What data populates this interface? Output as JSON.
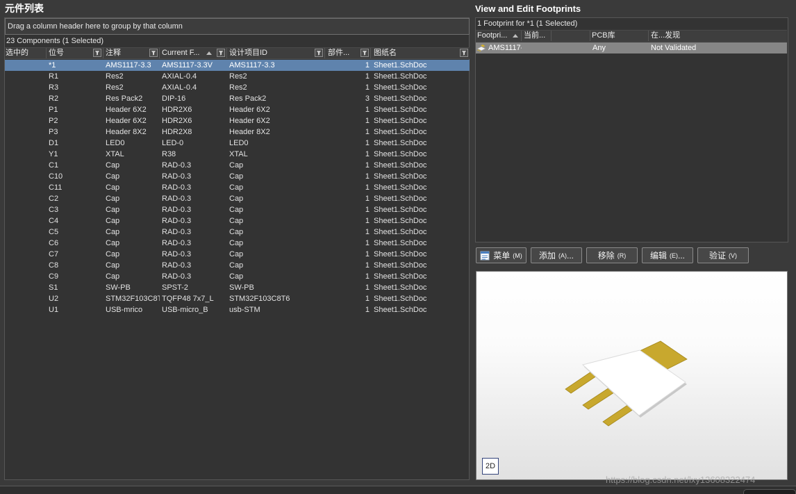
{
  "component_list": {
    "title": "元件列表",
    "group_hint": "Drag a column header here to group by that column",
    "summary": "23 Components (1 Selected)",
    "columns": [
      {
        "label": "选中的",
        "filter": false
      },
      {
        "label": "位号",
        "filter": true
      },
      {
        "label": "注释",
        "filter": true
      },
      {
        "label": "Current F...",
        "filter": true,
        "sort_icon": "sort-ascending-icon"
      },
      {
        "label": "设计项目ID",
        "filter": true
      },
      {
        "label": "部件...",
        "filter": true
      },
      {
        "label": "图纸名",
        "filter": true
      }
    ],
    "rows": [
      {
        "selected": true,
        "designator": "*1",
        "comment": "AMS1117-3.3",
        "current_footprint": "AMS1117-3.3V",
        "design_item_id": "AMS1117-3.3",
        "part_count": 1,
        "sheet": "Sheet1.SchDoc"
      },
      {
        "designator": "R1",
        "comment": "Res2",
        "current_footprint": "AXIAL-0.4",
        "design_item_id": "Res2",
        "part_count": 1,
        "sheet": "Sheet1.SchDoc"
      },
      {
        "designator": "R3",
        "comment": "Res2",
        "current_footprint": "AXIAL-0.4",
        "design_item_id": "Res2",
        "part_count": 1,
        "sheet": "Sheet1.SchDoc"
      },
      {
        "designator": "R2",
        "comment": "Res Pack2",
        "current_footprint": "DIP-16",
        "design_item_id": "Res Pack2",
        "part_count": 3,
        "sheet": "Sheet1.SchDoc"
      },
      {
        "designator": "P1",
        "comment": "Header 6X2",
        "current_footprint": "HDR2X6",
        "design_item_id": "Header 6X2",
        "part_count": 1,
        "sheet": "Sheet1.SchDoc"
      },
      {
        "designator": "P2",
        "comment": "Header 6X2",
        "current_footprint": "HDR2X6",
        "design_item_id": "Header 6X2",
        "part_count": 1,
        "sheet": "Sheet1.SchDoc"
      },
      {
        "designator": "P3",
        "comment": "Header 8X2",
        "current_footprint": "HDR2X8",
        "design_item_id": "Header 8X2",
        "part_count": 1,
        "sheet": "Sheet1.SchDoc"
      },
      {
        "designator": "D1",
        "comment": "LED0",
        "current_footprint": "LED-0",
        "design_item_id": "LED0",
        "part_count": 1,
        "sheet": "Sheet1.SchDoc"
      },
      {
        "designator": "Y1",
        "comment": "XTAL",
        "current_footprint": "R38",
        "design_item_id": "XTAL",
        "part_count": 1,
        "sheet": "Sheet1.SchDoc"
      },
      {
        "designator": "C1",
        "comment": "Cap",
        "current_footprint": "RAD-0.3",
        "design_item_id": "Cap",
        "part_count": 1,
        "sheet": "Sheet1.SchDoc"
      },
      {
        "designator": "C10",
        "comment": "Cap",
        "current_footprint": "RAD-0.3",
        "design_item_id": "Cap",
        "part_count": 1,
        "sheet": "Sheet1.SchDoc"
      },
      {
        "designator": "C11",
        "comment": "Cap",
        "current_footprint": "RAD-0.3",
        "design_item_id": "Cap",
        "part_count": 1,
        "sheet": "Sheet1.SchDoc"
      },
      {
        "designator": "C2",
        "comment": "Cap",
        "current_footprint": "RAD-0.3",
        "design_item_id": "Cap",
        "part_count": 1,
        "sheet": "Sheet1.SchDoc"
      },
      {
        "designator": "C3",
        "comment": "Cap",
        "current_footprint": "RAD-0.3",
        "design_item_id": "Cap",
        "part_count": 1,
        "sheet": "Sheet1.SchDoc"
      },
      {
        "designator": "C4",
        "comment": "Cap",
        "current_footprint": "RAD-0.3",
        "design_item_id": "Cap",
        "part_count": 1,
        "sheet": "Sheet1.SchDoc"
      },
      {
        "designator": "C5",
        "comment": "Cap",
        "current_footprint": "RAD-0.3",
        "design_item_id": "Cap",
        "part_count": 1,
        "sheet": "Sheet1.SchDoc"
      },
      {
        "designator": "C6",
        "comment": "Cap",
        "current_footprint": "RAD-0.3",
        "design_item_id": "Cap",
        "part_count": 1,
        "sheet": "Sheet1.SchDoc"
      },
      {
        "designator": "C7",
        "comment": "Cap",
        "current_footprint": "RAD-0.3",
        "design_item_id": "Cap",
        "part_count": 1,
        "sheet": "Sheet1.SchDoc"
      },
      {
        "designator": "C8",
        "comment": "Cap",
        "current_footprint": "RAD-0.3",
        "design_item_id": "Cap",
        "part_count": 1,
        "sheet": "Sheet1.SchDoc"
      },
      {
        "designator": "C9",
        "comment": "Cap",
        "current_footprint": "RAD-0.3",
        "design_item_id": "Cap",
        "part_count": 1,
        "sheet": "Sheet1.SchDoc"
      },
      {
        "designator": "S1",
        "comment": "SW-PB",
        "current_footprint": "SPST-2",
        "design_item_id": "SW-PB",
        "part_count": 1,
        "sheet": "Sheet1.SchDoc"
      },
      {
        "designator": "U2",
        "comment": "STM32F103C8T",
        "current_footprint": "TQFP48 7x7_L",
        "design_item_id": "STM32F103C8T6",
        "part_count": 1,
        "sheet": "Sheet1.SchDoc"
      },
      {
        "designator": "U1",
        "comment": "USB-mrico",
        "current_footprint": "USB-micro_B",
        "design_item_id": "usb-STM",
        "part_count": 1,
        "sheet": "Sheet1.SchDoc"
      }
    ]
  },
  "footprint_editor": {
    "title": "View and Edit Footprints",
    "summary": "1 Footprint for *1 (1 Selected)",
    "columns": [
      {
        "label": "Footpri...",
        "sort_icon": "sort-ascending-icon"
      },
      {
        "label": "当前..."
      },
      {},
      {
        "label": "PCB库"
      },
      {
        "label": "在...发现"
      }
    ],
    "rows": [
      {
        "selected": true,
        "icon": "footprint-icon",
        "footprint": "AMS1117-",
        "pcb_library": "Any",
        "found_in": "Not Validated"
      }
    ],
    "buttons": [
      {
        "icon": "menu-icon",
        "label": "菜单",
        "shortcut": "(M)"
      },
      {
        "label": "添加",
        "shortcut": "(A)",
        "suffix": "..."
      },
      {
        "label": "移除",
        "shortcut": "(R)"
      },
      {
        "label": "编辑",
        "shortcut": "(E)",
        "suffix": "..."
      },
      {
        "label": "验证",
        "shortcut": "(V)"
      }
    ],
    "preview": {
      "view_mode_button": "2D"
    }
  },
  "watermark": "https://blog.csdn.net/lxy13608322474",
  "colors": {
    "window_background": "#3a3a3a",
    "panel_background": "#333333",
    "selection_blue": "#5f83ad",
    "selection_gray": "#868686",
    "pad_gold": "#c8a82e"
  }
}
